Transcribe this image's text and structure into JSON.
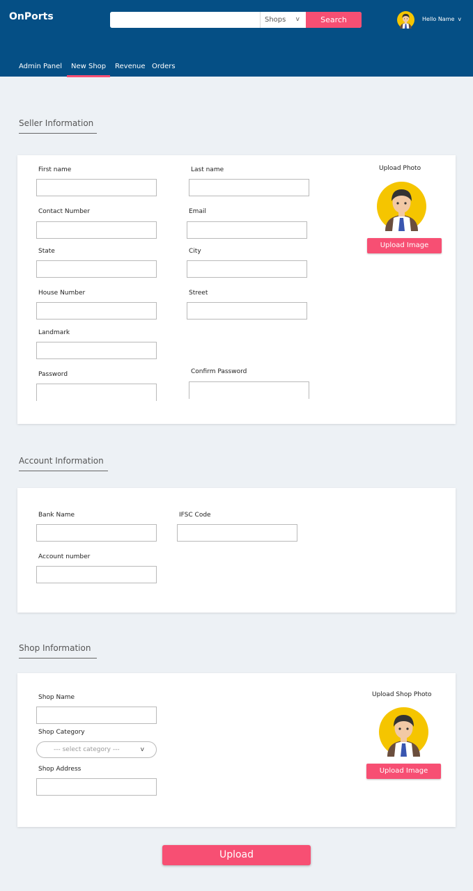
{
  "header": {
    "brand": "OnPorts",
    "search": {
      "placeholder": "",
      "category": "Shops",
      "button": "Search"
    },
    "user": {
      "greeting": "Hello Name"
    }
  },
  "nav": {
    "items": [
      "Admin Panel",
      "New Shop",
      "Revenue",
      "Orders"
    ],
    "active": "New Shop"
  },
  "seller": {
    "title": "Seller Information",
    "first_name": "First name",
    "last_name": "Last name",
    "contact": "Contact Number",
    "email": "Email",
    "state": "State",
    "city": "City",
    "house": "House Number",
    "street": "Street",
    "landmark": "Landmark",
    "password": "Password",
    "confirm_password": "Confirm Password",
    "photo_label": "Upload Photo",
    "upload_button": "Upload Image"
  },
  "account": {
    "title": "Account Information",
    "bank_name": "Bank Name",
    "ifsc": "IFSC Code",
    "account_number": "Account number"
  },
  "shop": {
    "title": "Shop Information",
    "shop_name": "Shop Name",
    "category_label": "Shop Category",
    "category_placeholder": "--- select category ---",
    "address": "Shop Address",
    "photo_label": "Upload Shop Photo",
    "upload_button": "Upload Image"
  },
  "footer": {
    "upload_button": "Upload"
  },
  "colors": {
    "header": "#054f85",
    "accent": "#f74f73",
    "background": "#edf1f5",
    "avatar_bg": "#f5c500"
  },
  "icons": {
    "avatar": "avatar-icon",
    "chevron": "chevron-down-icon"
  }
}
